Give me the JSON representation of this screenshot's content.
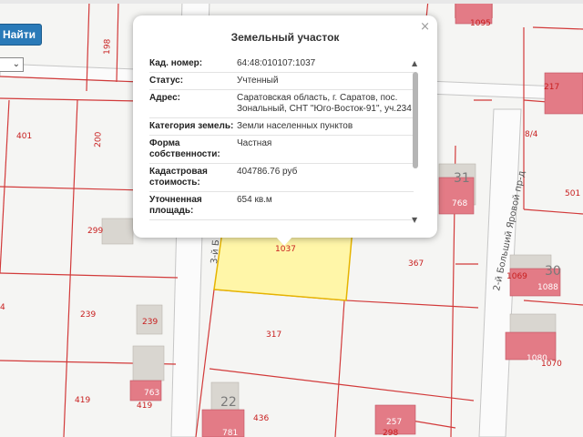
{
  "toolbar": {
    "find_label": "Найти"
  },
  "popup": {
    "title": "Земельный участок",
    "close_glyph": "×",
    "rows": [
      {
        "label": "Кад. номер:",
        "value": "64:48:010107:1037"
      },
      {
        "label": "Статус:",
        "value": "Учтенный"
      },
      {
        "label": "Адрес:",
        "value": "Саратовская область, г. Саратов, пос. Зональный, СНТ \"Юго-Восток-91\", уч.234"
      },
      {
        "label": "Категория земель:",
        "value": "Земли населенных пунктов"
      },
      {
        "label": "Форма собственности:",
        "value": "Частная"
      },
      {
        "label": "Кадастровая стоимость:",
        "value": "404786.76 руб"
      },
      {
        "label": "Уточненная площадь:",
        "value": "654 кв.м"
      }
    ]
  },
  "map": {
    "selected_parcel": "1037",
    "parcel_labels": [
      "1095",
      "198",
      "217",
      "401",
      "200",
      "8/4",
      "31",
      "768",
      "501",
      "299",
      "367",
      "1069",
      "30",
      "1088",
      "4",
      "239",
      "239",
      "317",
      "1080",
      "1070",
      "419",
      "763",
      "419",
      "22",
      "436",
      "257",
      "298",
      "781"
    ],
    "streets": [
      "2-й Больший Яровой пр-д",
      "3-й Б"
    ],
    "colors": {
      "selected_fill": "#fff6a8",
      "selected_stroke": "#e6b400",
      "boundary": "#d23a3a",
      "building_pink": "#e37b86",
      "building_grey": "#d9d6d0"
    }
  }
}
